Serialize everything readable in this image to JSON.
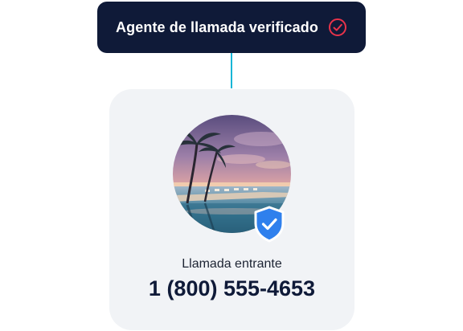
{
  "banner": {
    "label": "Agente de llamada verificado",
    "icon": "check-circle-icon",
    "background_color": "#0f1a38",
    "icon_color": "#e8334a"
  },
  "connector": {
    "color": "#17b6d6"
  },
  "call_card": {
    "avatar_image": "beach-resort-pool-sunset",
    "badge_icon": "shield-check-icon",
    "badge_color": "#2f80ed",
    "status_text": "Llamada entrante",
    "phone_number": "1 (800) 555-4653"
  }
}
